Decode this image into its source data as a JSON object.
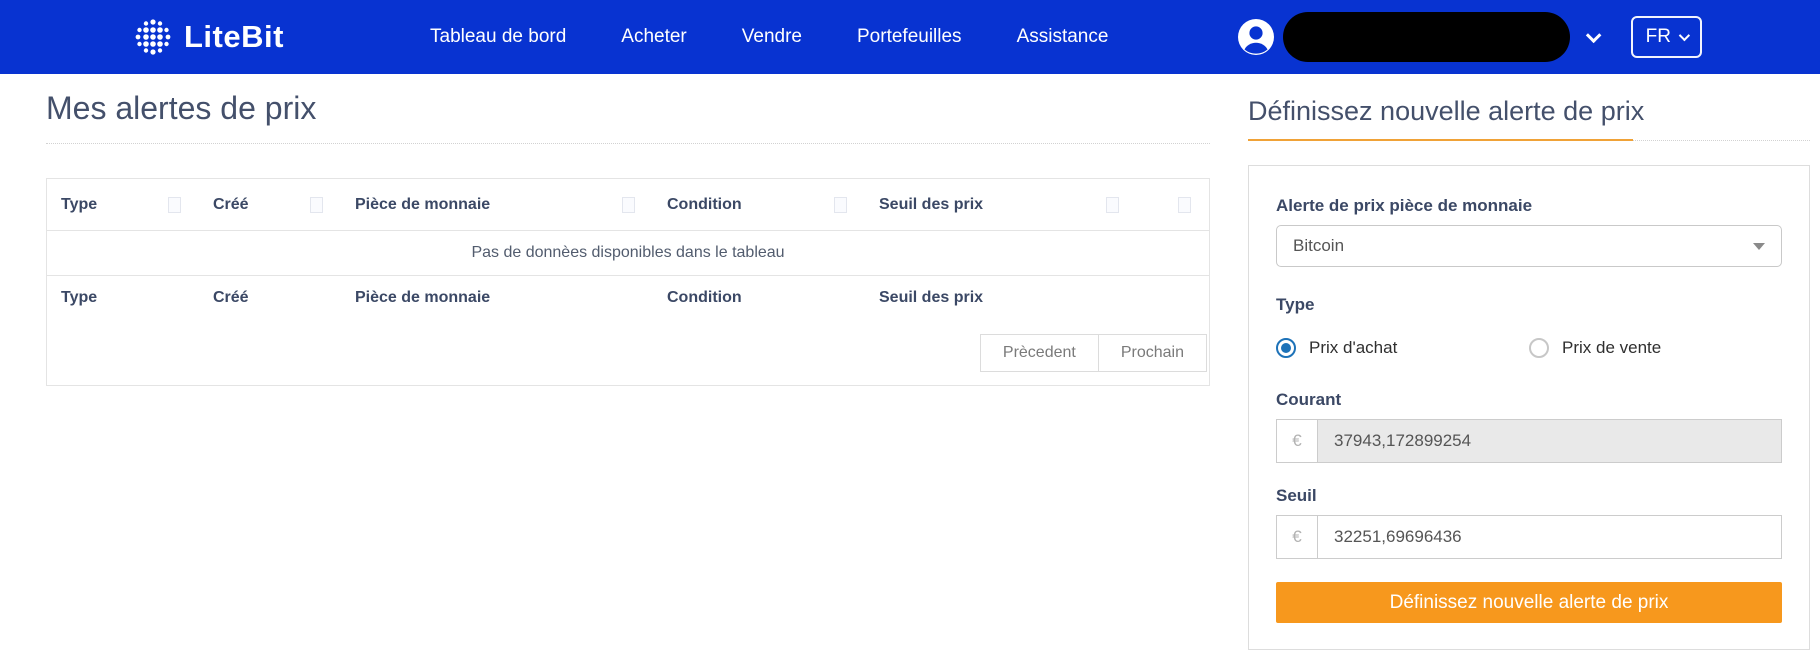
{
  "navbar": {
    "brand": "LiteBit",
    "items": [
      {
        "label": "Tableau de bord"
      },
      {
        "label": "Acheter"
      },
      {
        "label": "Vendre"
      },
      {
        "label": "Portefeuilles"
      },
      {
        "label": "Assistance"
      }
    ],
    "language": "FR"
  },
  "page": {
    "title": "Mes alertes de prix"
  },
  "alerts_table": {
    "columns": [
      "Type",
      "Créé",
      "Pièce de monnaie",
      "Condition",
      "Seuil des prix",
      ""
    ],
    "empty_message": "Pas de donnèes disponibles dans le tableau",
    "footer_columns": [
      "Type",
      "Créé",
      "Pièce de monnaie",
      "Condition",
      "Seuil des prix"
    ],
    "pagination": {
      "previous": "Prècedent",
      "next": "Prochain"
    }
  },
  "form": {
    "title": "Définissez nouvelle alerte de prix",
    "coin_label": "Alerte de prix pièce de monnaie",
    "coin_value": "Bitcoin",
    "type_label": "Type",
    "type_options": [
      {
        "label": "Prix d'achat",
        "selected": true
      },
      {
        "label": "Prix de vente",
        "selected": false
      }
    ],
    "current_label": "Courant",
    "currency_symbol": "€",
    "current_value": "37943,172899254",
    "threshold_label": "Seuil",
    "threshold_value": "32251,69696436",
    "submit_label": "Définissez nouvelle alerte de prix"
  },
  "colors": {
    "navbar_blue": "#0833d1",
    "accent_orange": "#f7981d",
    "heading_slate": "#44506b",
    "radio_blue": "#1d72b8"
  }
}
